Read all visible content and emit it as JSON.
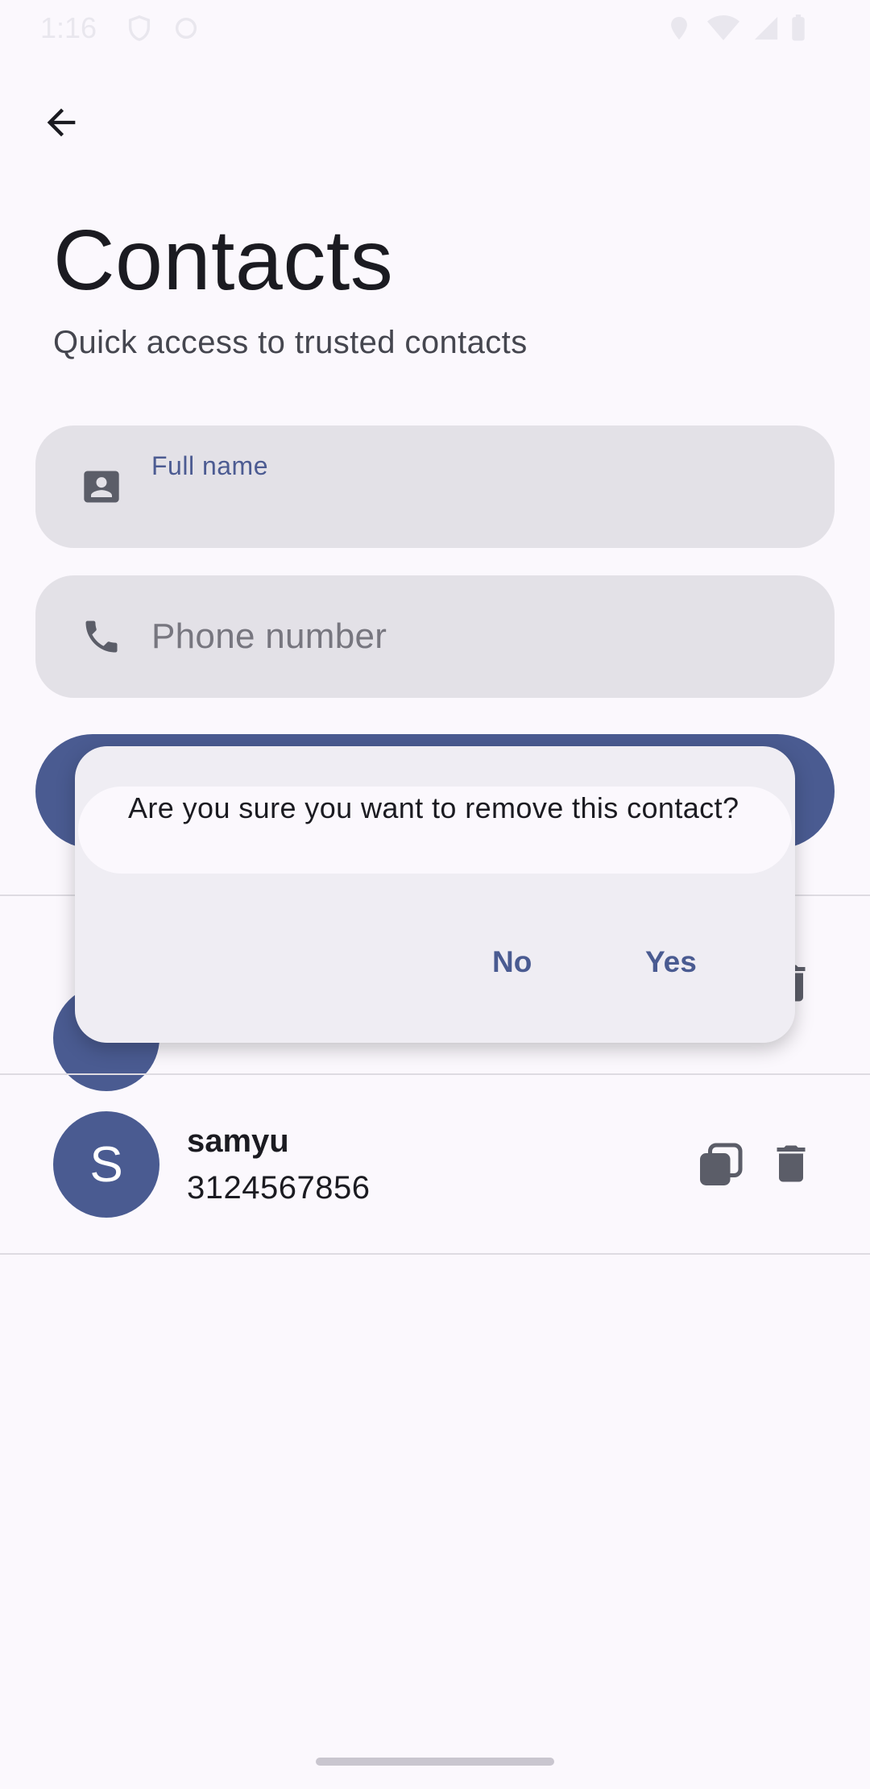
{
  "status_bar": {
    "time": "1:16"
  },
  "header": {
    "back_icon": "arrow-back-icon",
    "title": "Contacts",
    "subtitle": "Quick access to trusted contacts"
  },
  "form": {
    "name_field": {
      "label": "Full name",
      "value": "",
      "icon": "contact-card-icon"
    },
    "phone_field": {
      "placeholder": "Phone number",
      "value": "",
      "icon": "phone-icon"
    }
  },
  "contacts": [
    {
      "initial": "S",
      "name": "samyu",
      "phone": "3124567856"
    }
  ],
  "dialog": {
    "message": "Are you sure you want to remove this contact?",
    "no_label": "No",
    "yes_label": "Yes"
  },
  "colors": {
    "primary": "#4a5b91",
    "background": "#fbf8fd",
    "field_bg": "#e3e1e7",
    "dialog_bg": "#efedf3"
  }
}
